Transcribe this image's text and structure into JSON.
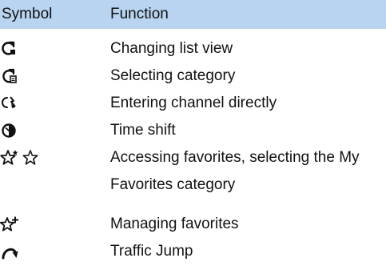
{
  "header": {
    "symbol_label": "Symbol",
    "function_label": "Function"
  },
  "rows": [
    {
      "icon": "list-view-icon",
      "function": "Changing list view"
    },
    {
      "icon": "category-icon",
      "function": "Selecting category"
    },
    {
      "icon": "channel-entry-icon",
      "function": "Entering channel directly"
    },
    {
      "icon": "time-shift-icon",
      "function": "Time shift"
    },
    {
      "icon": "favorites-stars-icon",
      "function": "Accessing favorites, selecting the My Favorites category"
    },
    {
      "icon": "manage-favorites-icon",
      "function": "Managing favorites"
    },
    {
      "icon": "traffic-jump-icon",
      "function": "Traffic Jump"
    }
  ],
  "colors": {
    "header_background": "#b8d4f0",
    "text": "#111111"
  }
}
